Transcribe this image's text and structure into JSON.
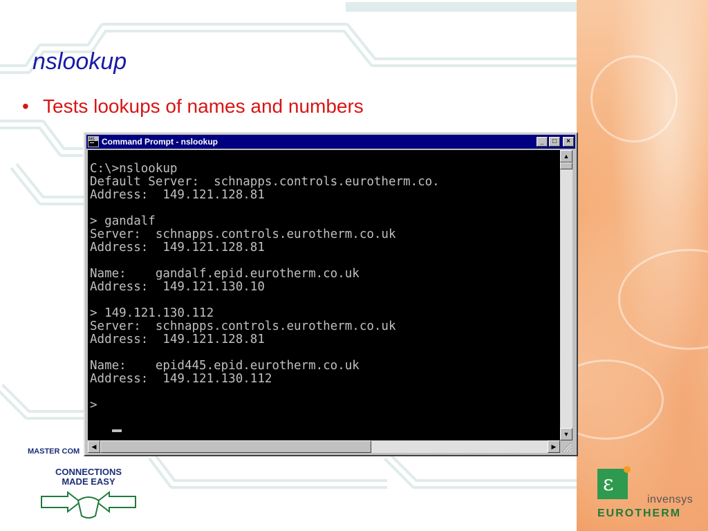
{
  "slide": {
    "title": "nslookup",
    "bullet_marker": "•",
    "bullet_text": "Tests lookups of names and numbers",
    "colors": {
      "title": "#1a1aa6",
      "bullet": "#d81414"
    }
  },
  "window": {
    "title": "Command Prompt - nslookup",
    "buttons": {
      "minimize": "_",
      "maximize": "□",
      "close": "×"
    },
    "console_lines": [
      "C:\\>nslookup",
      "Default Server:  schnapps.controls.eurotherm.co.",
      "Address:  149.121.128.81",
      "",
      "> gandalf",
      "Server:  schnapps.controls.eurotherm.co.uk",
      "Address:  149.121.128.81",
      "",
      "Name:    gandalf.epid.eurotherm.co.uk",
      "Address:  149.121.130.10",
      "",
      "> 149.121.130.112",
      "Server:  schnapps.controls.eurotherm.co.uk",
      "Address:  149.121.128.81",
      "",
      "Name:    epid445.epid.eurotherm.co.uk",
      "Address:  149.121.130.112",
      "",
      "> "
    ],
    "scroll_arrows": {
      "up": "▲",
      "down": "▼",
      "left": "◀",
      "right": "▶"
    }
  },
  "footer": {
    "master_text": "MASTER COM",
    "logo_line1": "CONNECTIONS",
    "logo_line2": "MADE EASY",
    "brand_sub": "invensys",
    "brand_main": "EUROTHERM",
    "brand_letter": "ε"
  }
}
